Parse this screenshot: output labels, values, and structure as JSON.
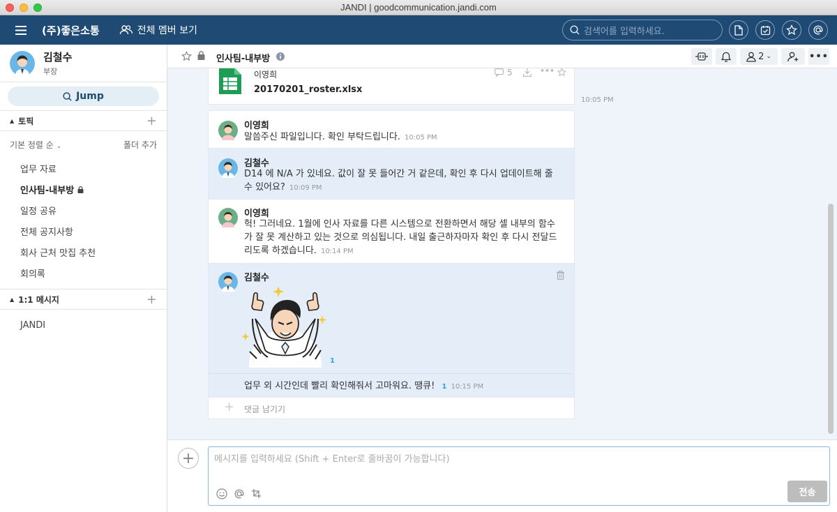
{
  "window": {
    "title": "JANDI | goodcommunication.jandi.com"
  },
  "header": {
    "company": "(주)좋은소통",
    "members_label": "전체 멤버 보기",
    "search_placeholder": "검색어를 입력하세요."
  },
  "profile": {
    "name": "김철수",
    "role": "부장"
  },
  "sidebar": {
    "jump_label": "Jump",
    "topics_title": "토픽",
    "sort_label": "기본 정렬 순",
    "add_folder_label": "폴더 추가",
    "topics": [
      {
        "label": "업무 자료"
      },
      {
        "label": "인사팀-내부방"
      },
      {
        "label": "일정 공유"
      },
      {
        "label": "전체 공지사항"
      },
      {
        "label": "회사 근처 맛집 추천"
      },
      {
        "label": "회의록"
      }
    ],
    "dm_title": "1:1 메시지",
    "dms": [
      {
        "label": "JANDI"
      }
    ]
  },
  "channel": {
    "name": "인사팀-내부방",
    "member_count": "2"
  },
  "file_card": {
    "sender": "이영희",
    "file_name": "20170201_roster.xlsx",
    "comment_count": "5",
    "time": "10:05 PM"
  },
  "messages": [
    {
      "sender": "이영희",
      "text": "말씀주신 파일입니다. 확인 부탁드립니다.",
      "time": "10:05 PM"
    },
    {
      "sender": "김철수",
      "text": "D14 에 N/A 가 있네요. 값이 잘 못 들어간 거 같은데, 확인 후 다시 업데이트해 줄 수 있어요?",
      "time": "10:09 PM"
    },
    {
      "sender": "이영희",
      "text": "헉! 그러네요. 1월에 인사 자료를 다른 시스템으로 전환하면서 해당 셀 내부의 함수가 잘 못 계산하고 있는 것으로 의심됩니다. 내일 출근하자마자 확인 후 다시 전달드리도록 하겠습니다.",
      "time": "10:14 PM"
    },
    {
      "sender": "김철수",
      "sticker_unread": "1",
      "text": "업무 외 시간인데 빨리 확인해줘서 고마워요. 땡큐!",
      "unread": "1",
      "time": "10:15 PM"
    }
  ],
  "comment_placeholder": "댓글 남기기",
  "composer": {
    "placeholder": "메시지를 입력하세요 (Shift + Enter로 줄바꿈이 가능합니다)",
    "send_label": "전송"
  },
  "colors": {
    "header_bg": "#1f4a74",
    "accent": "#2aa3e0",
    "message_area_bg": "#eef4fa"
  }
}
